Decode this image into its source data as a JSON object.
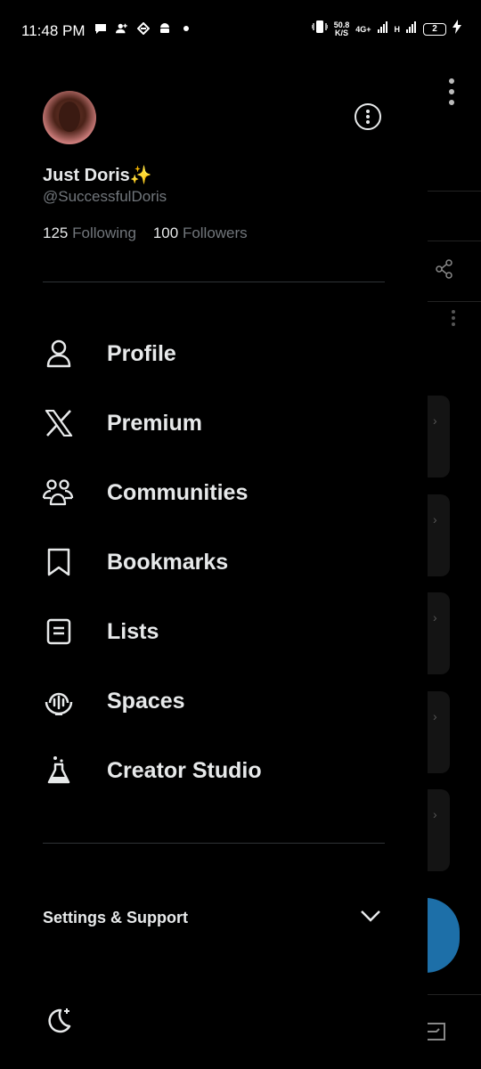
{
  "status": {
    "time": "11:48 PM",
    "net_speed_value": "50.8",
    "net_speed_unit": "K/S",
    "network": "4G+",
    "network2": "H",
    "battery": "2"
  },
  "account": {
    "display_name": "Just Doris✨",
    "handle": "@SuccessfulDoris",
    "following_count": "125",
    "following_label": "Following",
    "followers_count": "100",
    "followers_label": "Followers"
  },
  "menu": [
    {
      "label": "Profile",
      "icon": "person-icon"
    },
    {
      "label": "Premium",
      "icon": "x-logo-icon"
    },
    {
      "label": "Communities",
      "icon": "communities-icon"
    },
    {
      "label": "Bookmarks",
      "icon": "bookmark-icon"
    },
    {
      "label": "Lists",
      "icon": "list-icon"
    },
    {
      "label": "Spaces",
      "icon": "spaces-icon"
    },
    {
      "label": "Creator Studio",
      "icon": "flask-icon"
    }
  ],
  "settings": {
    "label": "Settings & Support"
  },
  "colors": {
    "background": "#000000",
    "text": "#e7e9ea",
    "muted": "#71767b",
    "divider": "#2f3336",
    "fab": "#1d6fa8"
  }
}
